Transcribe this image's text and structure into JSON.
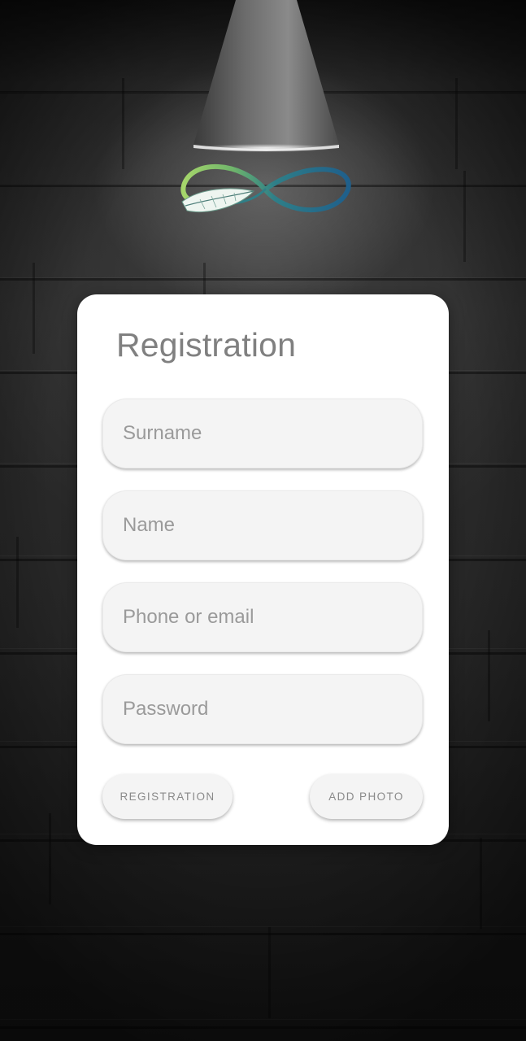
{
  "form": {
    "title": "Registration",
    "fields": [
      {
        "placeholder": "Surname",
        "value": ""
      },
      {
        "placeholder": "Name",
        "value": ""
      },
      {
        "placeholder": "Phone or email",
        "value": ""
      },
      {
        "placeholder": "Password",
        "value": ""
      }
    ],
    "register_button": "REGISTRATION",
    "add_photo_button": "ADD PHOTO"
  },
  "icons": {
    "lamp": "ceiling-lamp-icon",
    "logo": "infinity-feather-logo"
  },
  "colors": {
    "card_background": "#ffffff",
    "field_background": "#f4f4f4",
    "title_text": "#808080",
    "placeholder_text": "#9a9a9a",
    "button_text": "#8a8a8a",
    "logo_green": "#8cc63f",
    "logo_blue": "#1f5f8b"
  }
}
